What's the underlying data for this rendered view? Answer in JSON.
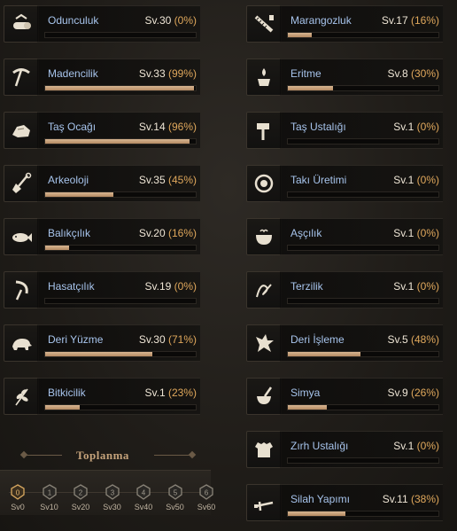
{
  "left_skills": [
    {
      "icon": "log-icon",
      "name": "Odunculuk",
      "level": "Sv.30",
      "percent": "(0%)",
      "progress": 0
    },
    {
      "icon": "pickaxe-icon",
      "name": "Madencilik",
      "level": "Sv.33",
      "percent": "(99%)",
      "progress": 99
    },
    {
      "icon": "stone-icon",
      "name": "Taş Ocağı",
      "level": "Sv.14",
      "percent": "(96%)",
      "progress": 96
    },
    {
      "icon": "shovel-icon",
      "name": "Arkeoloji",
      "level": "Sv.35",
      "percent": "(45%)",
      "progress": 45
    },
    {
      "icon": "fish-icon",
      "name": "Balıkçılık",
      "level": "Sv.20",
      "percent": "(16%)",
      "progress": 16
    },
    {
      "icon": "sickle-icon",
      "name": "Hasatçılık",
      "level": "Sv.19",
      "percent": "(0%)",
      "progress": 0
    },
    {
      "icon": "boar-icon",
      "name": "Deri Yüzme",
      "level": "Sv.30",
      "percent": "(71%)",
      "progress": 71
    },
    {
      "icon": "herb-icon",
      "name": "Bitkicilik",
      "level": "Sv.1",
      "percent": "(23%)",
      "progress": 23
    }
  ],
  "right_skills": [
    {
      "icon": "saw-icon",
      "name": "Marangozluk",
      "level": "Sv.17",
      "percent": "(16%)",
      "progress": 16
    },
    {
      "icon": "smelting-icon",
      "name": "Eritme",
      "level": "Sv.8",
      "percent": "(30%)",
      "progress": 30
    },
    {
      "icon": "hammer-icon",
      "name": "Taş Ustalığı",
      "level": "Sv.1",
      "percent": "(0%)",
      "progress": 0
    },
    {
      "icon": "gem-icon",
      "name": "Takı Üretimi",
      "level": "Sv.1",
      "percent": "(0%)",
      "progress": 0
    },
    {
      "icon": "cauldron-icon",
      "name": "Aşçılık",
      "level": "Sv.1",
      "percent": "(0%)",
      "progress": 0
    },
    {
      "icon": "needle-icon",
      "name": "Terzilik",
      "level": "Sv.1",
      "percent": "(0%)",
      "progress": 0
    },
    {
      "icon": "leather-icon",
      "name": "Deri İşleme",
      "level": "Sv.5",
      "percent": "(48%)",
      "progress": 48
    },
    {
      "icon": "mortar-icon",
      "name": "Simya",
      "level": "Sv.9",
      "percent": "(26%)",
      "progress": 26
    },
    {
      "icon": "armor-icon",
      "name": "Zırh Ustalığı",
      "level": "Sv.1",
      "percent": "(0%)",
      "progress": 0
    },
    {
      "icon": "sword-icon",
      "name": "Silah Yapımı",
      "level": "Sv.11",
      "percent": "(38%)",
      "progress": 38
    }
  ],
  "gathering": {
    "title": "Toplanma",
    "tiers": [
      {
        "label": "Sv0",
        "badge": "0"
      },
      {
        "label": "Sv10",
        "badge": "1"
      },
      {
        "label": "Sv20",
        "badge": "2"
      },
      {
        "label": "Sv30",
        "badge": "3"
      },
      {
        "label": "Sv40",
        "badge": "4"
      },
      {
        "label": "Sv50",
        "badge": "5"
      },
      {
        "label": "Sv60",
        "badge": "6"
      }
    ]
  },
  "colors": {
    "skill_name": "#a7c4ec",
    "level_text": "#efe6d6",
    "percent_text": "#e0a85c",
    "bar_fill": "#c9a57d",
    "section_title": "#c4a27a"
  }
}
